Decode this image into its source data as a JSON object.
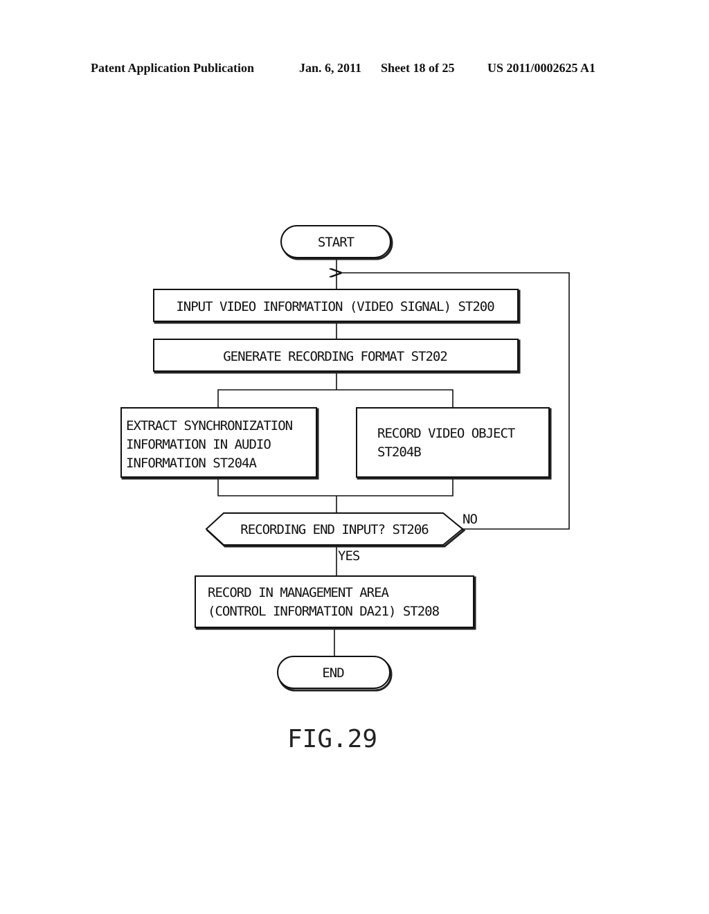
{
  "header": {
    "publication": "Patent Application Publication",
    "date": "Jan. 6, 2011",
    "sheet": "Sheet 18 of 25",
    "number": "US 2011/0002625 A1"
  },
  "flowchart": {
    "start": "START",
    "end": "END",
    "steps": {
      "st200": "INPUT VIDEO INFORMATION (VIDEO SIGNAL) ST200",
      "st202": "GENERATE RECORDING FORMAT ST202",
      "st204a": [
        "EXTRACT SYNCHRONIZATION",
        "INFORMATION IN AUDIO",
        "INFORMATION ST204A"
      ],
      "st204b": [
        "RECORD VIDEO OBJECT",
        "ST204B"
      ],
      "st206": "RECORDING END INPUT? ST206",
      "st208": [
        "RECORD IN MANAGEMENT AREA",
        "(CONTROL INFORMATION DA21) ST208"
      ]
    },
    "branch_labels": {
      "yes": "YES",
      "no": "NO"
    }
  },
  "figure_label": "FIG.29"
}
